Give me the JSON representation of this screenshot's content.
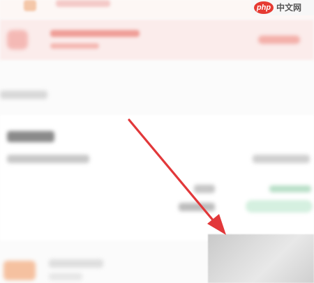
{
  "watermark": {
    "logo_text": "php",
    "site_text": "中文网",
    "logo_color": "#e63a32"
  },
  "colors": {
    "banner_bg": "#fbeceb",
    "banner_accent": "#ef9e97",
    "status_green": "#d5f0e0",
    "arrow_red": "#e2383a",
    "highlight_grey": "#d6d6d6"
  },
  "icons": {
    "top_icon": "app-icon",
    "banner_icon": "notice-icon",
    "bottom_icon": "product-thumbnail"
  }
}
